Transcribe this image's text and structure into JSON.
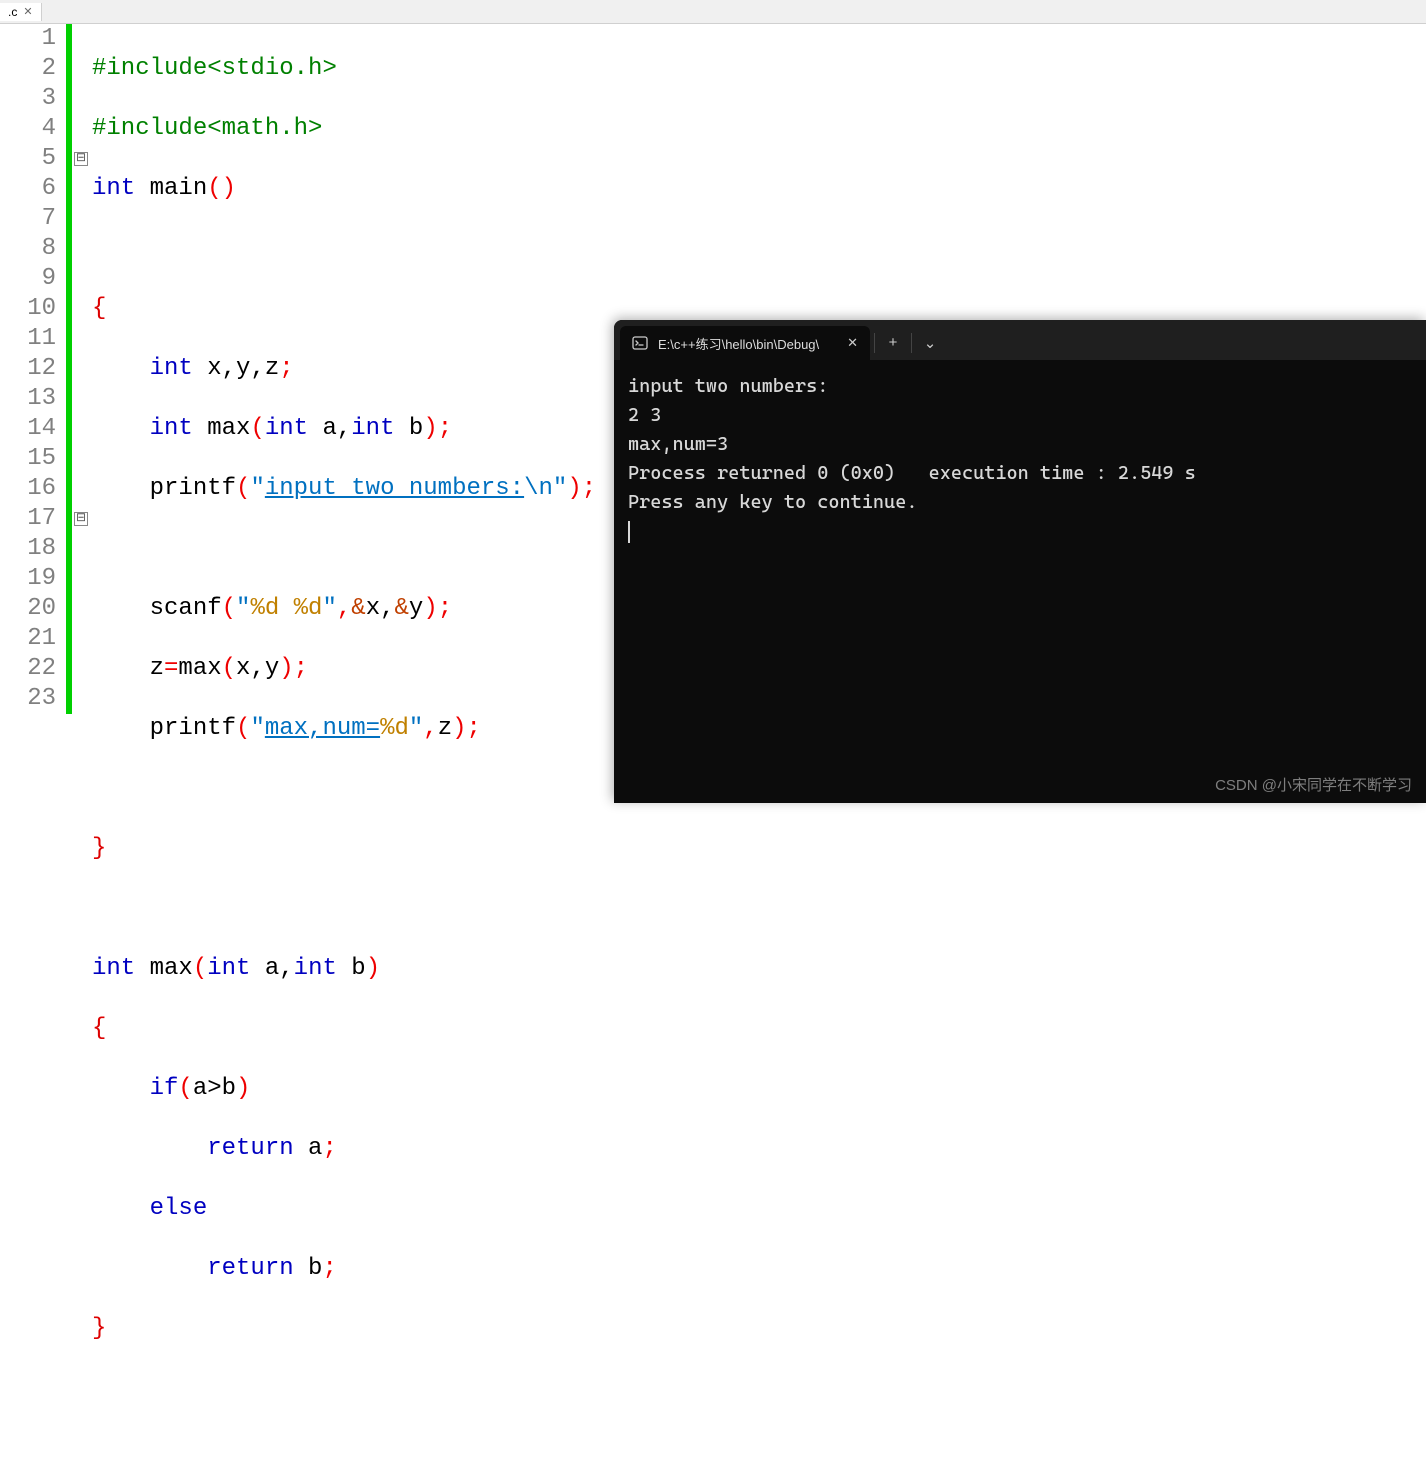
{
  "tab": {
    "filename": ".c",
    "close": "✕"
  },
  "gutter": [
    "1",
    "2",
    "3",
    "4",
    "5",
    "6",
    "7",
    "8",
    "9",
    "10",
    "11",
    "12",
    "13",
    "14",
    "15",
    "16",
    "17",
    "18",
    "19",
    "20",
    "21",
    "22",
    "23"
  ],
  "fold": {
    "l5": "⊟",
    "l17": "⊟"
  },
  "code": {
    "l1": {
      "inc": "#include",
      "hdr": "<stdio.h>"
    },
    "l2": {
      "inc": "#include",
      "hdr": "<math.h>"
    },
    "l3": {
      "int": "int",
      "main": " main",
      "op": "(",
      "cp": ")"
    },
    "l5": {
      "ob": "{"
    },
    "l6": {
      "int": "int",
      "vars": " x,y,z",
      "semi": ";"
    },
    "l7": {
      "int": "int",
      "max": " max",
      "op": "(",
      "int2": "int",
      "a": " a,",
      "int3": "int",
      "b": " b",
      "cp": ")",
      "semi": ";"
    },
    "l8": {
      "pf": "printf",
      "op": "(",
      "q1": "\"",
      "s": "input two numbers:",
      "esc": "\\n",
      "q2": "\"",
      "cp": ")",
      "semi": ";"
    },
    "l10": {
      "sf": "scanf",
      "op": "(",
      "q1": "\"",
      "f1": "%d",
      "sp": " ",
      "f2": "%d",
      "q2": "\"",
      "c1": ",",
      "amp1": "&",
      "x": "x,",
      "amp2": "&",
      "y": "y",
      "cp": ")",
      "semi": ";"
    },
    "l11": {
      "z": "z",
      "eq": "=",
      "max": "max",
      "op": "(",
      "args": "x,y",
      "cp": ")",
      "semi": ";"
    },
    "l12": {
      "pf": "printf",
      "op": "(",
      "q1": "\"",
      "s": "max,num=",
      "f": "%d",
      "q2": "\"",
      "c": ",",
      "z": "z",
      "cp": ")",
      "semi": ";"
    },
    "l14": {
      "cb": "}"
    },
    "l16": {
      "int": "int",
      "max": " max",
      "op": "(",
      "int2": "int",
      "a": " a,",
      "int3": "int",
      "b": " b",
      "cp": ")"
    },
    "l17": {
      "ob": "{"
    },
    "l18": {
      "if": "if",
      "op": "(",
      "cond": "a>b",
      "cp": ")"
    },
    "l19": {
      "ret": "return",
      "a": " a",
      "semi": ";"
    },
    "l20": {
      "else": "else"
    },
    "l21": {
      "ret": "return",
      "b": " b",
      "semi": ";"
    },
    "l22": {
      "cb": "}"
    }
  },
  "terminal": {
    "title": "E:\\c++练习\\hello\\bin\\Debug\\",
    "tab_close": "✕",
    "new_tab": "+",
    "dropdown": "⌄",
    "lines": [
      "input two numbers:",
      "2 3",
      "max,num=3",
      "Process returned 0 (0x0)   execution time : 2.549 s",
      "Press any key to continue."
    ]
  },
  "watermark": "CSDN @小宋同学在不断学习"
}
